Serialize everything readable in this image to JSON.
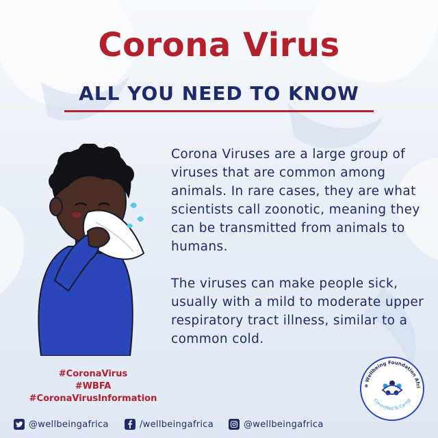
{
  "title": "Corona Virus",
  "subtitle": "ALL YOU NEED TO KNOW",
  "paragraphs": [
    "Corona Viruses are a large group of viruses that are common among animals. In rare cases, they are what scientists call zoonotic, meaning they can be transmitted from animals to humans.",
    "The viruses can make people sick, usually with a mild to moderate upper respiratory tract illness, similar to a common cold."
  ],
  "hashtags": [
    "#CoronaVirus",
    "#WBFA",
    "#CoronaVirusInformation"
  ],
  "logo": {
    "org_name": "The Wellbeing Foundation Africa",
    "tagline": "Committed To Caring"
  },
  "social": {
    "twitter": "@wellbeingafrica",
    "facebook": "/wellbeingafrica",
    "instagram": "@wellbeingafrica"
  },
  "colors": {
    "title_red": "#b3202b",
    "navy": "#1f2a6b",
    "shirt_blue": "#2b46b8"
  }
}
